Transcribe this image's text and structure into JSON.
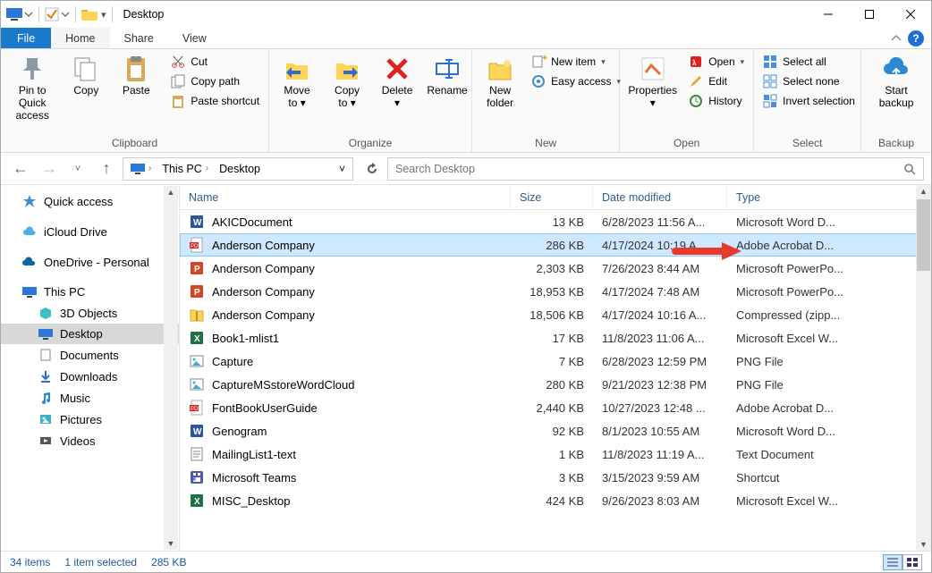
{
  "title": "Desktop",
  "tabs": {
    "file": "File",
    "home": "Home",
    "share": "Share",
    "view": "View"
  },
  "ribbon": {
    "clipboard": {
      "label": "Clipboard",
      "pin": "Pin to Quick access",
      "copy": "Copy",
      "paste": "Paste",
      "cut": "Cut",
      "copy_path": "Copy path",
      "paste_shortcut": "Paste shortcut"
    },
    "organize": {
      "label": "Organize",
      "move_to": "Move to",
      "copy_to": "Copy to",
      "delete": "Delete",
      "rename": "Rename"
    },
    "new": {
      "label": "New",
      "new_folder": "New folder",
      "new_item": "New item",
      "easy_access": "Easy access"
    },
    "open": {
      "label": "Open",
      "properties": "Properties",
      "open": "Open",
      "edit": "Edit",
      "history": "History"
    },
    "select": {
      "label": "Select",
      "select_all": "Select all",
      "select_none": "Select none",
      "invert": "Invert selection"
    },
    "backup": {
      "label": "Backup",
      "start_backup": "Start backup"
    }
  },
  "breadcrumb": {
    "root": "This PC",
    "leaf": "Desktop"
  },
  "search_placeholder": "Search Desktop",
  "sidebar": {
    "quick_access": "Quick access",
    "icloud": "iCloud Drive",
    "onedrive": "OneDrive - Personal",
    "this_pc": "This PC",
    "objects3d": "3D Objects",
    "desktop": "Desktop",
    "documents": "Documents",
    "downloads": "Downloads",
    "music": "Music",
    "pictures": "Pictures",
    "videos": "Videos"
  },
  "columns": {
    "name": "Name",
    "size": "Size",
    "date": "Date modified",
    "type": "Type"
  },
  "files": [
    {
      "icon": "word",
      "name": "AKICDocument",
      "size": "13 KB",
      "date": "6/28/2023 11:56 A...",
      "type": "Microsoft Word D...",
      "selected": false
    },
    {
      "icon": "pdf",
      "name": "Anderson Company",
      "size": "286 KB",
      "date": "4/17/2024 10:19 A...",
      "type": "Adobe Acrobat D...",
      "selected": true
    },
    {
      "icon": "ppt",
      "name": "Anderson Company",
      "size": "2,303 KB",
      "date": "7/26/2023 8:44 AM",
      "type": "Microsoft PowerPo...",
      "selected": false
    },
    {
      "icon": "ppt",
      "name": "Anderson Company",
      "size": "18,953 KB",
      "date": "4/17/2024 7:48 AM",
      "type": "Microsoft PowerPo...",
      "selected": false
    },
    {
      "icon": "zip",
      "name": "Anderson Company",
      "size": "18,506 KB",
      "date": "4/17/2024 10:16 A...",
      "type": "Compressed (zipp...",
      "selected": false
    },
    {
      "icon": "excel",
      "name": "Book1-mlist1",
      "size": "17 KB",
      "date": "11/8/2023 11:06 A...",
      "type": "Microsoft Excel W...",
      "selected": false
    },
    {
      "icon": "image",
      "name": "Capture",
      "size": "7 KB",
      "date": "6/28/2023 12:59 PM",
      "type": "PNG File",
      "selected": false
    },
    {
      "icon": "image",
      "name": "CaptureMSstoreWordCloud",
      "size": "280 KB",
      "date": "9/21/2023 12:38 PM",
      "type": "PNG File",
      "selected": false
    },
    {
      "icon": "pdf",
      "name": "FontBookUserGuide",
      "size": "2,440 KB",
      "date": "10/27/2023 12:48 ...",
      "type": "Adobe Acrobat D...",
      "selected": false
    },
    {
      "icon": "word",
      "name": "Genogram",
      "size": "92 KB",
      "date": "8/1/2023 10:55 AM",
      "type": "Microsoft Word D...",
      "selected": false
    },
    {
      "icon": "text",
      "name": "MailingList1-text",
      "size": "1 KB",
      "date": "11/8/2023 11:19 A...",
      "type": "Text Document",
      "selected": false
    },
    {
      "icon": "link",
      "name": "Microsoft Teams",
      "size": "3 KB",
      "date": "3/15/2023 9:59 AM",
      "type": "Shortcut",
      "selected": false
    },
    {
      "icon": "excel",
      "name": "MISC_Desktop",
      "size": "424 KB",
      "date": "9/26/2023 8:03 AM",
      "type": "Microsoft Excel W...",
      "selected": false
    }
  ],
  "status": {
    "count": "34 items",
    "selected": "1 item selected",
    "size": "285 KB"
  }
}
